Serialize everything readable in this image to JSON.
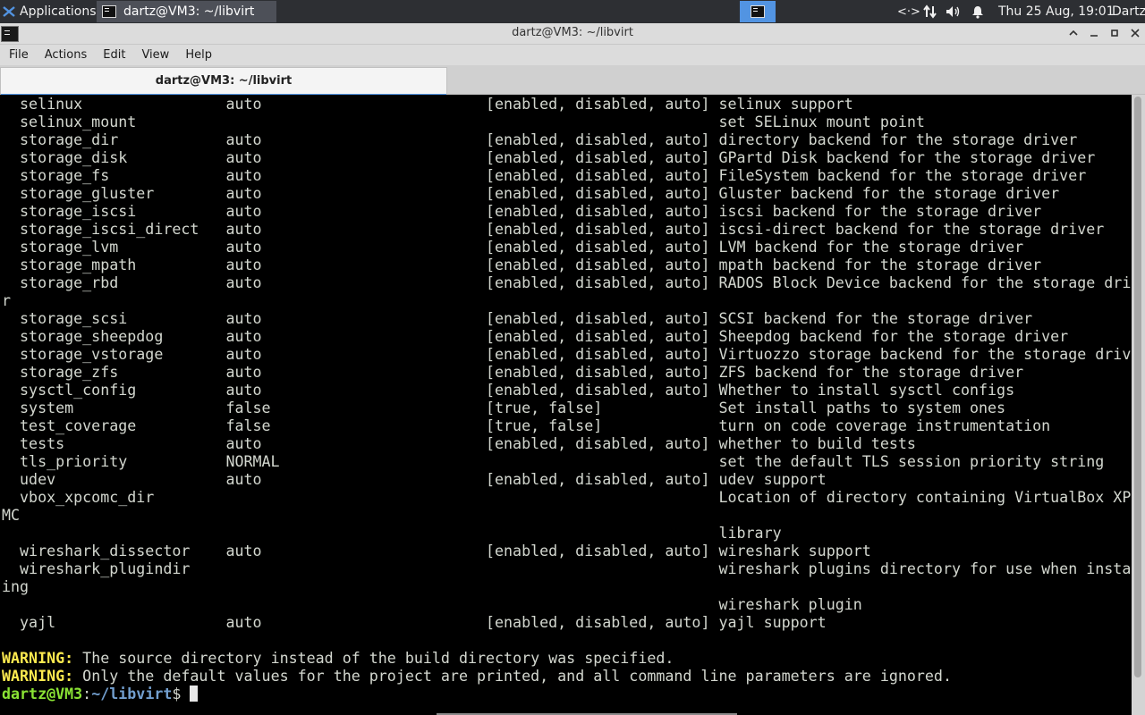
{
  "panel": {
    "apps_label": "Applications",
    "task_title": "dartz@VM3: ~/libvirt",
    "datetime": "Thu 25 Aug, 19:01",
    "user": "Dartz",
    "icons": [
      "xfce-icon",
      "terminal-icon",
      "network-icon",
      "transfer-icon",
      "volume-icon",
      "notification-bell-icon"
    ]
  },
  "window": {
    "title": "dartz@VM3: ~/libvirt",
    "menu": [
      "File",
      "Actions",
      "Edit",
      "View",
      "Help"
    ],
    "tab_label": "dartz@VM3: ~/libvirt"
  },
  "terminal": {
    "lines": [
      "  selinux                auto                         [enabled, disabled, auto] selinux support",
      "  selinux_mount                                                                 set SELinux mount point",
      "  storage_dir            auto                         [enabled, disabled, auto] directory backend for the storage driver",
      "  storage_disk           auto                         [enabled, disabled, auto] GPartd Disk backend for the storage driver",
      "  storage_fs             auto                         [enabled, disabled, auto] FileSystem backend for the storage driver",
      "  storage_gluster        auto                         [enabled, disabled, auto] Gluster backend for the storage driver",
      "  storage_iscsi          auto                         [enabled, disabled, auto] iscsi backend for the storage driver",
      "  storage_iscsi_direct   auto                         [enabled, disabled, auto] iscsi-direct backend for the storage driver",
      "  storage_lvm            auto                         [enabled, disabled, auto] LVM backend for the storage driver",
      "  storage_mpath          auto                         [enabled, disabled, auto] mpath backend for the storage driver",
      "  storage_rbd            auto                         [enabled, disabled, auto] RADOS Block Device backend for the storage drive",
      "r",
      "  storage_scsi           auto                         [enabled, disabled, auto] SCSI backend for the storage driver",
      "  storage_sheepdog       auto                         [enabled, disabled, auto] Sheepdog backend for the storage driver",
      "  storage_vstorage       auto                         [enabled, disabled, auto] Virtuozzo storage backend for the storage driver",
      "  storage_zfs            auto                         [enabled, disabled, auto] ZFS backend for the storage driver",
      "  sysctl_config          auto                         [enabled, disabled, auto] Whether to install sysctl configs",
      "  system                 false                        [true, false]             Set install paths to system ones",
      "  test_coverage          false                        [true, false]             turn on code coverage instrumentation",
      "  tests                  auto                         [enabled, disabled, auto] whether to build tests",
      "  tls_priority           NORMAL                                                 set the default TLS session priority string",
      "  udev                   auto                         [enabled, disabled, auto] udev support",
      "  vbox_xpcomc_dir                                                               Location of directory containing VirtualBox XPCO",
      "MC",
      "                                                                                library",
      "  wireshark_dissector    auto                         [enabled, disabled, auto] wireshark support",
      "  wireshark_plugindir                                                           wireshark plugins directory for use when install",
      "ing",
      "                                                                                wireshark plugin",
      "  yajl                   auto                         [enabled, disabled, auto] yajl support",
      ""
    ],
    "warnings": [
      {
        "label": "WARNING:",
        "text": " The source directory instead of the build directory was specified."
      },
      {
        "label": "WARNING:",
        "text": " Only the default values for the project are printed, and all command line parameters are ignored."
      }
    ],
    "prompt": {
      "user_host": "dartz@VM3",
      "sep": ":",
      "path": "~/libvirt",
      "symbol": "$ "
    }
  },
  "colors": {
    "panel_bg": "#2d2f33",
    "accent": "#5294e2",
    "terminal_bg": "#000000",
    "terminal_fg": "#d3d7cf",
    "warning": "#fce94f",
    "prompt_user": "#8ae234",
    "prompt_path": "#729fcf"
  }
}
